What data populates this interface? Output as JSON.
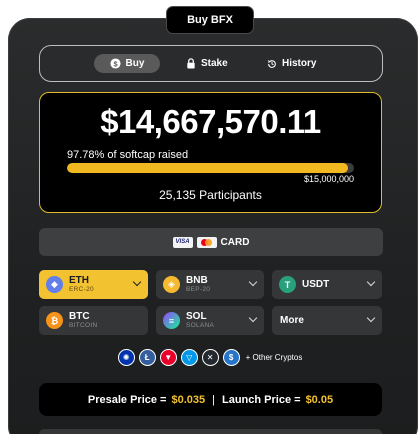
{
  "header": {
    "title": "Buy BFX"
  },
  "tabs": [
    {
      "label": "Buy",
      "icon": "dollar-circle-icon"
    },
    {
      "label": "Stake",
      "icon": "lock-icon"
    },
    {
      "label": "History",
      "icon": "history-clock-icon"
    }
  ],
  "presale": {
    "raised": "$14,667,570.11",
    "softcap_text": "97.78% of softcap raised",
    "progress_percent": 97.78,
    "cap": "$15,000,000",
    "participants": "25,135 Participants"
  },
  "card_option": {
    "label": "CARD",
    "visa_text": "VISA"
  },
  "coins": [
    {
      "symbol": "ETH",
      "network": "ERC-20",
      "color": "#627eea",
      "glyph": "◆",
      "active": true
    },
    {
      "symbol": "BNB",
      "network": "BEP-20",
      "color": "#f3ba2f",
      "glyph": "◈"
    },
    {
      "symbol": "USDT",
      "network": "",
      "color": "#26a17b",
      "glyph": "T"
    },
    {
      "symbol": "BTC",
      "network": "BITCOIN",
      "color": "#f7931a",
      "glyph": "₿"
    },
    {
      "symbol": "SOL",
      "network": "SOLANA",
      "color": "#9945ff",
      "glyph": "≡"
    },
    {
      "symbol": "More",
      "network": ""
    }
  ],
  "other_cryptos": {
    "label": "+ Other Cryptos",
    "icons": [
      {
        "name": "cardano-icon",
        "color": "#0033ad",
        "glyph": "✺"
      },
      {
        "name": "litecoin-icon",
        "color": "#345d9d",
        "glyph": "Ł"
      },
      {
        "name": "tron-icon",
        "color": "#eb0029",
        "glyph": "▼"
      },
      {
        "name": "toncoin-icon",
        "color": "#0098ea",
        "glyph": "▽"
      },
      {
        "name": "xrp-icon",
        "color": "#23292f",
        "glyph": "✕"
      },
      {
        "name": "usdc-icon",
        "color": "#2775ca",
        "glyph": "$"
      }
    ]
  },
  "price": {
    "presale_label": "Presale Price =",
    "presale_value": "$0.035",
    "separator": "|",
    "launch_label": "Launch Price =",
    "launch_value": "$0.05"
  }
}
